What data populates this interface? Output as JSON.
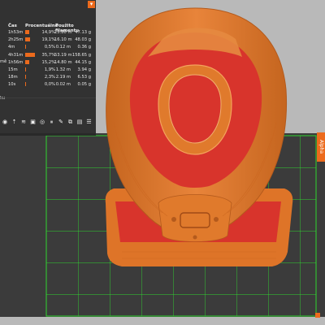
{
  "legend": {
    "collapse_glyph": "▾",
    "headers": {
      "time": "Čas",
      "percent": "Procentuálně",
      "used_filament": "Použito filamentu"
    },
    "rows": [
      {
        "time": "1h53m",
        "percent": "14,9%",
        "length": "15.80 m",
        "weight": "47.13 g",
        "fill": 0.149
      },
      {
        "time": "2h25m",
        "percent": "19,1%",
        "length": "16.10 m",
        "weight": "48.03 g",
        "fill": 0.191
      },
      {
        "time": "4m",
        "percent": "0,5%",
        "length": "0.12 m",
        "weight": "0.36 g",
        "fill": 0.005
      },
      {
        "time": "4h31m",
        "percent": "35,7%",
        "length": "53.19 m",
        "weight": "158.65 g",
        "fill": 0.357
      },
      {
        "time": "1h56m",
        "percent": "15,2%",
        "length": "14.80 m",
        "weight": "44.15 g",
        "fill": 0.152
      },
      {
        "time": "15m",
        "percent": "1,9%",
        "length": "1.32 m",
        "weight": "3.94 g",
        "fill": 0.019
      },
      {
        "time": "18m",
        "percent": "2,3%",
        "length": "2.19 m",
        "weight": "6.53 g",
        "fill": 0.023
      },
      {
        "time": "10s",
        "percent": "0,0%",
        "length": "0.02 m",
        "weight": "0.05 g",
        "fill": 0.0
      }
    ],
    "left_fragments": [
      "mě",
      "ku"
    ],
    "icons": [
      "color-change-icon",
      "retract-icon",
      "wipe-icon",
      "tool-marker-icon",
      "seam-icon",
      "pause-icon",
      "custom-gcode-icon",
      "sequential-icon",
      "shells-icon",
      "legend-icon"
    ]
  },
  "side_tab": {
    "label": "Alpha"
  },
  "colors": {
    "model_orange": "#e07a2c",
    "model_red": "#d8342c",
    "bed_grid": "#25d425",
    "bed_dark": "#3b3b3b",
    "accent": "#ec6a1c"
  }
}
